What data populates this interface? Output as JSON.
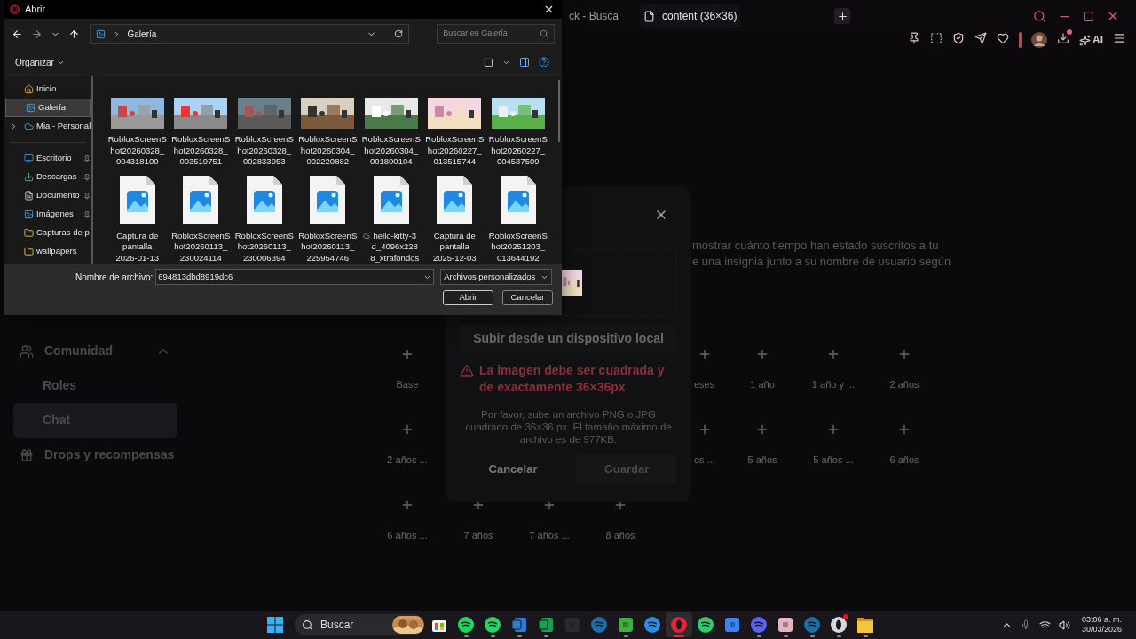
{
  "browser": {
    "tabs": [
      {
        "label": "ck - Busca",
        "selected": false
      },
      {
        "label": "content (36×36)",
        "selected": true
      }
    ],
    "toolbar": {
      "download_badge": true,
      "ai_label": "AI"
    }
  },
  "page": {
    "nav": [
      {
        "label": "Comunidad",
        "kind": "section",
        "expanded": true,
        "selected": false
      },
      {
        "label": "Roles",
        "kind": "sub",
        "selected": false
      },
      {
        "label": "Chat",
        "kind": "sub",
        "selected": true
      },
      {
        "label": "Drops y recompensas",
        "kind": "drops",
        "selected": false
      }
    ],
    "description": [
      "mostrar cuánto tiempo han estado suscritos a tu",
      "e una insignia junto a su nombre de usuario según"
    ],
    "badges": [
      [
        {
          "label": "Base"
        },
        {
          "kind": "covered"
        },
        {
          "kind": "covered"
        },
        {
          "kind": "covered"
        },
        {
          "label": "eses",
          "kind": "partial"
        },
        {
          "label": "1 año"
        },
        {
          "label": "1 año y ..."
        },
        {
          "label": "2 años"
        }
      ],
      [
        {
          "label": "2 años ..."
        },
        {
          "kind": "covered"
        },
        {
          "kind": "covered"
        },
        {
          "kind": "covered"
        },
        {
          "label": "os ...",
          "kind": "partial"
        },
        {
          "label": "5 años"
        },
        {
          "label": "5 años ..."
        },
        {
          "label": "6 años"
        }
      ],
      [
        {
          "label": "6 años ..."
        },
        {
          "label": "7 años"
        },
        {
          "label": "7 años ..."
        },
        {
          "label": "8 años"
        }
      ]
    ]
  },
  "modal": {
    "upload_button": "Subir desde un dispositivo local",
    "error": "La imagen debe ser cuadrada y de exactamente 36×36px",
    "help": "Por favor, sube un archivo PNG o JPG cuadrado de 36×36 px. El tamaño máximo de archivo es de 977KB.",
    "cancel": "Cancelar",
    "save": "Guardar",
    "save_disabled": true
  },
  "dialog": {
    "title": "Abrir",
    "path": "Galería",
    "search_placeholder": "Buscar en Galería",
    "organize": "Organizar",
    "sidebar": [
      {
        "label": "Inicio",
        "kind": "home",
        "pinned": false,
        "selected": false
      },
      {
        "label": "Galería",
        "kind": "gallery",
        "pinned": false,
        "selected": true
      },
      {
        "label": "Mia - Personal",
        "kind": "cloud",
        "pinned": false,
        "selected": false,
        "expandable": true
      },
      {
        "kind": "divider"
      },
      {
        "label": "Escritorio",
        "kind": "desktop",
        "pinned": true,
        "selected": false
      },
      {
        "label": "Descargas",
        "kind": "download",
        "pinned": true,
        "selected": false
      },
      {
        "label": "Documento",
        "kind": "document",
        "pinned": true,
        "selected": false
      },
      {
        "label": "Imágenes",
        "kind": "gallery",
        "pinned": true,
        "selected": false
      },
      {
        "label": "Capturas de p",
        "kind": "folder",
        "pinned": false,
        "selected": false
      },
      {
        "label": "wallpapers",
        "kind": "folder",
        "pinned": false,
        "selected": false
      }
    ],
    "files": [
      {
        "name": "RobloxScreenS\nhot20260328_\n004318100"
      },
      {
        "name": "RobloxScreenS\nhot20260328_\n003519751"
      },
      {
        "name": "RobloxScreenS\nhot20260328_\n002833953"
      },
      {
        "name": "RobloxScreenS\nhot20260304_\n002220882"
      },
      {
        "name": "RobloxScreenS\nhot20260304_\n001800104"
      },
      {
        "name": "RobloxScreenS\nhot20260227_\n013515744"
      },
      {
        "name": "RobloxScreenS\nhot20260227_\n004537509"
      },
      {
        "name": "Captura de\npantalla\n2026-01-13",
        "kind": "file"
      },
      {
        "name": "RobloxScreenS\nhot20260113_\n230024114",
        "kind": "file"
      },
      {
        "name": "RobloxScreenS\nhot20260113_\n230006394",
        "kind": "file"
      },
      {
        "name": "RobloxScreenS\nhot20260113_\n225954746",
        "kind": "file"
      },
      {
        "name": "hello-kitty-3\nd_4096x228\n8_xtrafondos",
        "kind": "file",
        "cloud": true
      },
      {
        "name": "Captura de\npantalla\n2025-12-03",
        "kind": "file"
      },
      {
        "name": "RobloxScreenS\nhot20251203_\n013644192",
        "kind": "file"
      }
    ],
    "filename_label": "Nombre de archivo:",
    "filename": "694813dbd8919dc6",
    "filetype": "Archivos personalizados",
    "open": "Abrir",
    "cancel": "Cancelar"
  },
  "taskbar": {
    "search": "Buscar",
    "apps": [
      {
        "kind": "bag",
        "color": "#f2f2f2",
        "running": false,
        "selected": false
      },
      {
        "kind": "round",
        "color": "#1ed760",
        "running": true,
        "selected": false
      },
      {
        "kind": "round",
        "color": "#25d366",
        "running": true,
        "selected": false
      },
      {
        "kind": "doc",
        "color": "#2b7cd3",
        "running": true,
        "selected": false
      },
      {
        "kind": "doc",
        "color": "#1f9d55",
        "running": true,
        "selected": false
      },
      {
        "kind": "square",
        "color": "#2a2a2a",
        "running": false,
        "selected": false
      },
      {
        "kind": "round",
        "color": "#1b6fa8",
        "running": false,
        "selected": false
      },
      {
        "kind": "square",
        "color": "#3fae3f",
        "running": true,
        "selected": false
      },
      {
        "kind": "round",
        "color": "#2a8ee8",
        "running": false,
        "selected": false
      },
      {
        "kind": "ring",
        "color": "#e0263b",
        "running": true,
        "selected": true
      },
      {
        "kind": "round",
        "color": "#2ecc71",
        "running": false,
        "selected": false
      },
      {
        "kind": "square",
        "color": "#3b82f6",
        "running": false,
        "selected": false
      },
      {
        "kind": "round",
        "color": "#5865f2",
        "running": true,
        "selected": false
      },
      {
        "kind": "square",
        "color": "#e8b4c0",
        "running": true,
        "selected": false
      },
      {
        "kind": "round",
        "color": "#1b6fa8",
        "running": true,
        "selected": false
      },
      {
        "kind": "ring",
        "color": "#d8d8d8",
        "running": true,
        "selected": false,
        "badge": true
      },
      {
        "kind": "folder",
        "color": "#f5c542",
        "running": true,
        "selected": false
      }
    ],
    "time": "03:06 a. m.",
    "date": "30/03/2026"
  }
}
